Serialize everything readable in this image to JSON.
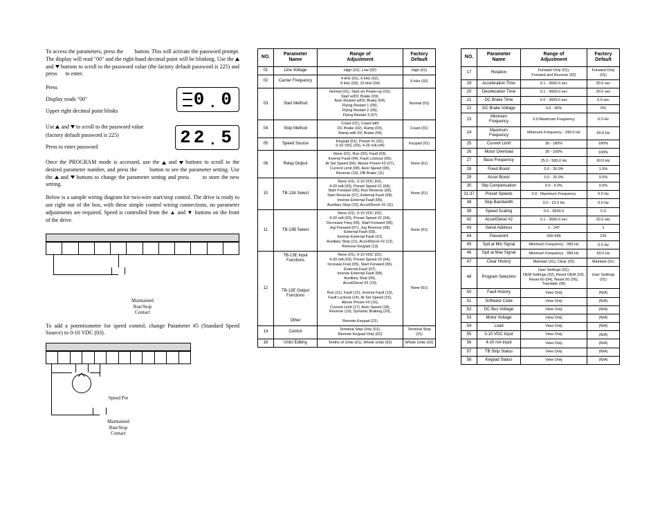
{
  "intro": {
    "para1_a": "To access the parameters, press the",
    "para1_b": "button. This will activate the password prompt. The display will read \"00\" and the right-hand decimal point will be blinking. Use the",
    "para1_c": "and",
    "para1_d": "buttons to scroll to the password value (the factory default password is 225) and press",
    "para1_e": "to enter.",
    "press": "Press",
    "display_reads": "Display reads \"00\"",
    "decimal_blinks": "Upper right decimal point blinks",
    "scroll_a": "Use",
    "scroll_b": "and",
    "scroll_c": "to scroll to the password value (factory default password is 225)",
    "press_enter": "Press            to enter password",
    "lcd1_left": "0",
    "lcd1_right": "0",
    "lcd2_left": "22",
    "lcd2_right": "5"
  },
  "prog": {
    "a": "Once the PROGRAM mode is accessed, use the",
    "b": "and",
    "c": "buttons to scroll to the desired parameter number, and press the",
    "d": "button to see the parameter setting. Use the",
    "e": "and",
    "f": "buttons to change the parameter setting and press",
    "g": "to store the new setting."
  },
  "wiring_intro": "Below is a sample wiring diagram for two-wire start/stop control. The drive is ready to use right out of the box, with these simple control wiring connections, no parameter adjustments are required. Speed is controlled from the  ▲  and  ▼  buttons on the front of the drive.",
  "maintained": "Maintained\nRun/Stop\nContact",
  "pot_intro": "To add a potentiometer for speed control, change Parameter #5 (Standard Speed Source) to 0-10 VDC (03).",
  "speed_pot_label": "Speed Pot",
  "maintained2": "Maintained\nRun/Stop\nContact",
  "table_headers": {
    "no": "NO.",
    "name": "Parameter\nName",
    "range": "Range of\nAdjustment",
    "def": "Factory\nDefault"
  },
  "table1": [
    {
      "no": "01",
      "name": "Line Voltage",
      "range": "High (01), Low (02)",
      "def": "High (01)"
    },
    {
      "no": "02",
      "name": "Carrier Frequency",
      "range": "4 kHz (01), 6 kHz (02),\n8 kHz (03), 10 kHz (04)",
      "def": "6 kHz (02)"
    },
    {
      "no": "03",
      "name": "Start Method",
      "range": "Normal (01), Start on Power-up (02),\nStart w/DC Brake (03),\nAuto Restart w/DC Brake (04),\nFlying Restart 1 (05),\nFlying Restart 2 (06),\nFlying Restart 3 (07)",
      "def": "Normal (01)"
    },
    {
      "no": "04",
      "name": "Stop Method",
      "range": "Coast (01), Coast with\nDC Brake (02), Ramp (03),\nRamp with DC Brake (04)",
      "def": "Coast (01)"
    },
    {
      "no": "05",
      "name": "Speed Source",
      "range": "Keypad (01), Preset #1 (02),\n0-10 VDC (03), 4-20 mA (04)",
      "def": "Keypad (01)"
    },
    {
      "no": "06",
      "name": "Relay Output",
      "range": "None (01), Run (02), Fault (03),\nInverse Fault (04), Fault Lockout (05),\nAt Set Speed (06), Above Preset #3 (07),\nCurrent Limit (08), Auto Speed (09),\nReverse (10), DB Brake (11)",
      "def": "None (01)"
    },
    {
      "no": "10",
      "name": "TB-13A Select",
      "range": "None (01), 0-10 VDC (02),\n4-20 mA (03), Preset Speed #1 (04),\nStart Forward (05), Run Reverse (06),\nStart Reverse (07), External Fault (08),\nInverse External Fault (09),\nAuxiliary Stop (10), Accel/Decel #2 (11)",
      "def": "None (01)"
    },
    {
      "no": "11",
      "name": "TB-13B Select",
      "range": "None (01), 0-10 VDC (02),\n4-20 mA (03), Preset Speed #2 (04),\nDecrease Freq (05), Start Forward (06),\nJog Forward (07), Jog Reverse (08),\nExternal Fault (09),\nInverse External Fault (10),\nAuxiliary Stop (11), Accel/Decel #2 (12),\nRemove Keypad (13)",
      "def": "None (01)"
    },
    {
      "no": "12",
      "name": "TB-13E Input Functions\n\n\n\n\n\nTB-13E Output Functions\n\n\n\n\nOther",
      "range": "None (01), 0-10 VDC (02),\n4-20 mA (03), Preset Speed #3 (04),\nIncrease Freq (05), Start Forward (06),\nExternal Fault (07),\nInverse External Fault (08),\nAuxiliary Stop (09),\nAccel/Decel #2 (10),\n\nRun (11), Fault (12), Inverse Fault (13),\nFault Lockout (14), At Set Speed (15),\nAbove Preset #3 (16),\nCurrent Limit (17), Auto Speed (18),\nReverse (19), Dynamic Braking (20),\n\nRemote Keypad (21)",
      "def": "None (01)"
    },
    {
      "no": "14",
      "name": "Control",
      "range": "Terminal Strip Only (01),\nRemote Keypad Only (02)",
      "def": "Terminal Strip\n(01)"
    },
    {
      "no": "16",
      "name": "Units Editing",
      "range": "Tenths of Units (01), Whole Units (02)",
      "def": "Whole Units (02)"
    }
  ],
  "table2": [
    {
      "no": "17",
      "name": "Rotation",
      "range": "Forward Only (01),\nForward and Reverse (02)",
      "def": "Forward Only\n(01)"
    },
    {
      "no": "19",
      "name": "Acceleration Time",
      "range": "0.1 - 3600.0 sec",
      "def": "20.0 sec"
    },
    {
      "no": "20",
      "name": "Deceleration Time",
      "range": "0.1 - 3600.0 sec",
      "def": "20.0 sec"
    },
    {
      "no": "21",
      "name": "DC Brake Time",
      "range": "0.0 - 3600.0 sec",
      "def": "0.0 sec"
    },
    {
      "no": "22",
      "name": "DC Brake Voltage",
      "range": "0.0 - 30%",
      "def": "0%"
    },
    {
      "no": "23",
      "name": "Minimum\nFrequency",
      "range": "0.0-Maximum Frequency",
      "def": "0.0 Hz"
    },
    {
      "no": "24",
      "name": "Maximum\nFrequency",
      "range": "Minimum Frequency - 240.0 Hz",
      "def": "60.0 Hz"
    },
    {
      "no": "25",
      "name": "Current Limit",
      "range": "30 - 180%",
      "def": "180%"
    },
    {
      "no": "26",
      "name": "Motor Overload",
      "range": "30 - 100%",
      "def": "100%"
    },
    {
      "no": "27",
      "name": "Base Frequency",
      "range": "25.0 - 500.0 Hz",
      "def": "60.0 Hz"
    },
    {
      "no": "28",
      "name": "Fixed Boost",
      "range": "0.0 - 30.0%",
      "def": "1.0%"
    },
    {
      "no": "29",
      "name": "Accel Boost",
      "range": "0.0 - 20.0%",
      "def": "0.0%"
    },
    {
      "no": "30",
      "name": "Slip Compensation",
      "range": "0.0 - 5.0%",
      "def": "0.0%"
    },
    {
      "no": "31-37",
      "name": "Preset Speeds",
      "range": "0.0 - Maximum Frequency",
      "def": "0.0 Hz"
    },
    {
      "no": "38",
      "name": "Skip Bandwidth",
      "range": "0.0 - 10.0 Hz",
      "def": "0.0 Hz"
    },
    {
      "no": "39",
      "name": "Speed Scaling",
      "range": "0.0 - 6500.0",
      "def": "0.0"
    },
    {
      "no": "42",
      "name": "Accel/Decel #2",
      "range": "0.1 - 3600.0 sec",
      "def": "20.0 sec"
    },
    {
      "no": "43",
      "name": "Serial Address",
      "range": "1 - 247",
      "def": "1"
    },
    {
      "no": "44",
      "name": "Password",
      "range": "000-999",
      "def": "225"
    },
    {
      "no": "45",
      "name": "Spd at Min Signal",
      "range": "Minimum Frequency - 999 Hz",
      "def": "0.0 Hz"
    },
    {
      "no": "46",
      "name": "Spd at Max Signal",
      "range": "Minimum Frequency - 999 Hz",
      "def": "60.0 Hz"
    },
    {
      "no": "47",
      "name": "Clear History",
      "range": "Maintain (01), Clear (02)",
      "def": "Maintain (01)"
    },
    {
      "no": "48",
      "name": "Program Selection",
      "range": "User Settings (01),\nOEM Settings (02), Reset OEM (03),\nReset 60 (04), Reset 50 (05),\nTranslate (06)",
      "def": "User Settings\n(01)"
    },
    {
      "no": "50",
      "name": "Fault History",
      "range": "View Only",
      "def": "(N/A)"
    },
    {
      "no": "51",
      "name": "Software Code",
      "range": "View Only",
      "def": "(N/A)"
    },
    {
      "no": "52",
      "name": "DC Bus Voltage",
      "range": "View Only",
      "def": "(N/A)"
    },
    {
      "no": "53",
      "name": "Motor Voltage",
      "range": "View Only",
      "def": "(N/A)"
    },
    {
      "no": "54",
      "name": "Load",
      "range": "View Only",
      "def": "(N/A)"
    },
    {
      "no": "55",
      "name": "0-10 VDC Input",
      "range": "View Only",
      "def": "(N/A)"
    },
    {
      "no": "56",
      "name": "4-20 mA Input",
      "range": "View Only",
      "def": "(N/A)"
    },
    {
      "no": "57",
      "name": "TB Strip Status",
      "range": "View Only",
      "def": "(N/A)"
    },
    {
      "no": "58",
      "name": "Keypad Status",
      "range": "View Only",
      "def": "(N/A)"
    }
  ]
}
